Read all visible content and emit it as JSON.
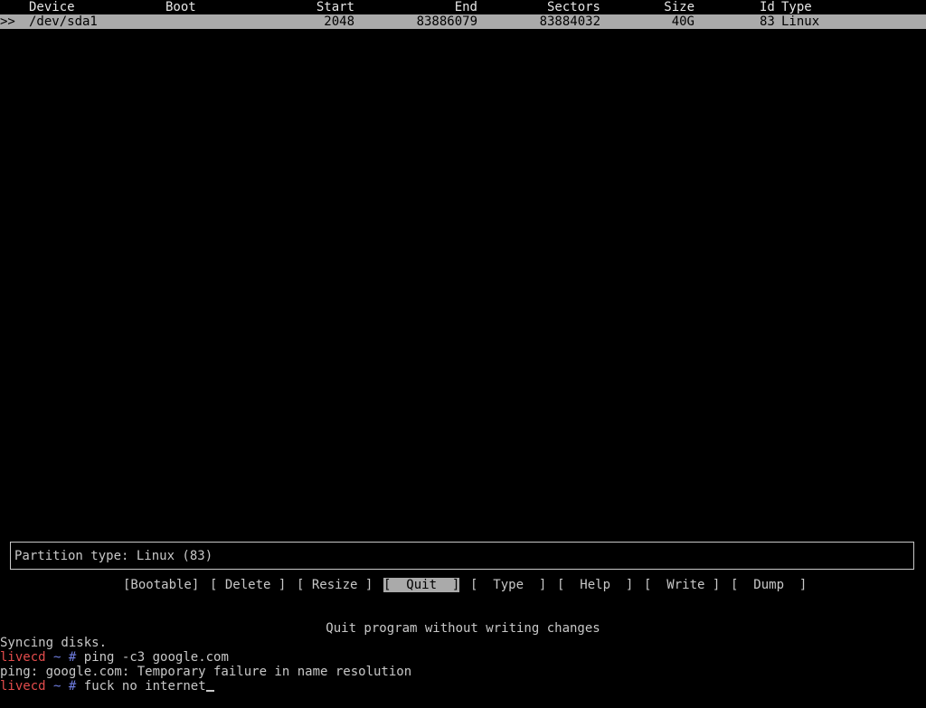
{
  "table": {
    "headers": {
      "device": "Device",
      "boot": "Boot",
      "start": "Start",
      "end": "End",
      "sectors": "Sectors",
      "size": "Size",
      "id": "Id",
      "type": "Type"
    },
    "selector": ">>",
    "rows": [
      {
        "device": "/dev/sda1",
        "boot": "",
        "start": "2048",
        "end": "83886079",
        "sectors": "83884032",
        "size": "40G",
        "id": "83",
        "type": "Linux"
      }
    ]
  },
  "status": {
    "text": "Partition type: Linux (83)"
  },
  "menu": {
    "items": [
      {
        "label": "[Bootable]",
        "active": false
      },
      {
        "label": "[ Delete ]",
        "active": false
      },
      {
        "label": "[ Resize ]",
        "active": false
      },
      {
        "label": "[  Quit  ]",
        "active": true
      },
      {
        "label": "[  Type  ]",
        "active": false
      },
      {
        "label": "[  Help  ]",
        "active": false
      },
      {
        "label": "[  Write ]",
        "active": false
      },
      {
        "label": "[  Dump  ]",
        "active": false
      }
    ],
    "help_text": "Quit program without writing changes"
  },
  "terminal": {
    "lines": [
      {
        "kind": "output",
        "text": "Syncing disks."
      },
      {
        "kind": "prompt",
        "host": "livecd",
        "tilde": "~",
        "hash": "#",
        "command": "ping -c3 google.com"
      },
      {
        "kind": "output",
        "text": "ping: google.com: Temporary failure in name resolution"
      },
      {
        "kind": "prompt",
        "host": "livecd",
        "tilde": "~",
        "hash": "#",
        "command": "fuck no internet"
      }
    ]
  },
  "colors": {
    "background": "#000000",
    "foreground": "#c8c8c8",
    "highlight": "#aaaaaa",
    "prompt_host": "#e34c4c",
    "prompt_symbol": "#6f7de0"
  }
}
